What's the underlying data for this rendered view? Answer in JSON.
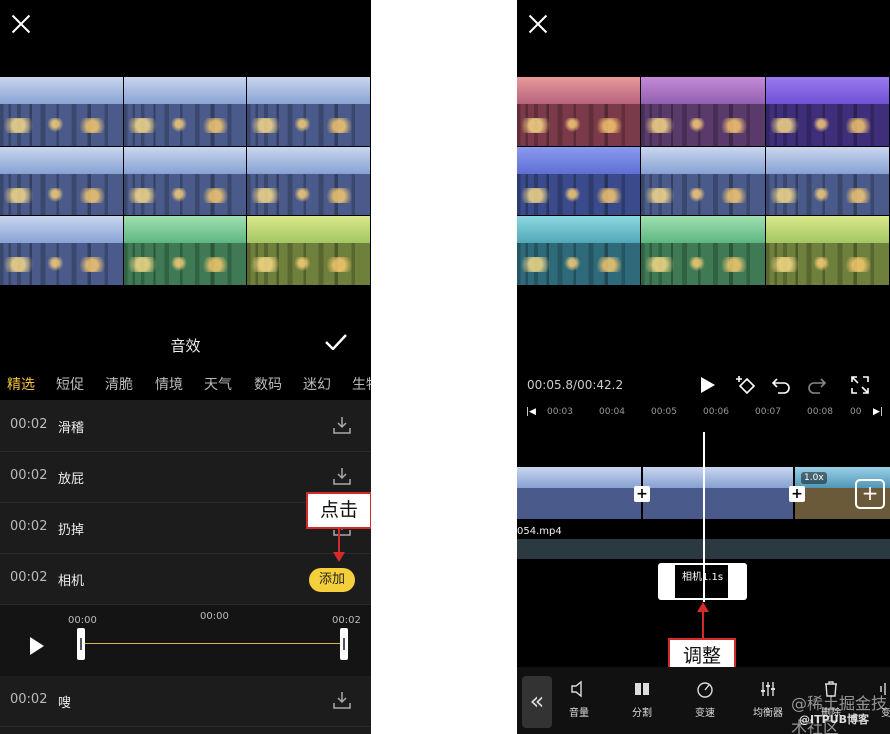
{
  "left_screen": {
    "sheet_title": "音效",
    "categories": [
      "精选",
      "短促",
      "清脆",
      "情境",
      "天气",
      "数码",
      "迷幻",
      "生物"
    ],
    "sounds": [
      {
        "duration": "00:02",
        "name": "滑稽"
      },
      {
        "duration": "00:02",
        "name": "放屁"
      },
      {
        "duration": "00:02",
        "name": "扔掉"
      },
      {
        "duration": "00:02",
        "name": "相机"
      },
      {
        "duration": "00:02",
        "name": "嗖"
      }
    ],
    "add_label": "添加",
    "trim": {
      "ticks": [
        "00:00",
        "00:00",
        "00:02"
      ]
    },
    "callout": "点击"
  },
  "right_screen": {
    "time_display": "00:05.8/00:42.2",
    "ruler_ticks": [
      "00:03",
      "00:04",
      "00:05",
      "00:06",
      "00:07",
      "00:08",
      "00"
    ],
    "speed_badge": "1.0x",
    "audio_track_name": "054.mp4",
    "sfx_clip_label": "相机1.1s",
    "callout": "调整",
    "toolbar": [
      {
        "label": "音量",
        "icon": "volume-icon"
      },
      {
        "label": "分割",
        "icon": "split-icon"
      },
      {
        "label": "变速",
        "icon": "speed-icon"
      },
      {
        "label": "均衡器",
        "icon": "equalizer-icon"
      },
      {
        "label": "删除",
        "icon": "delete-icon"
      },
      {
        "label": "变",
        "icon": "voice-change-icon"
      }
    ],
    "watermark": "@稀土掘金技术社区",
    "watermark2": "@ITPUB博客"
  },
  "colors": {
    "accent_yellow": "#f5c23b",
    "annotation_red": "#d42a2a"
  }
}
